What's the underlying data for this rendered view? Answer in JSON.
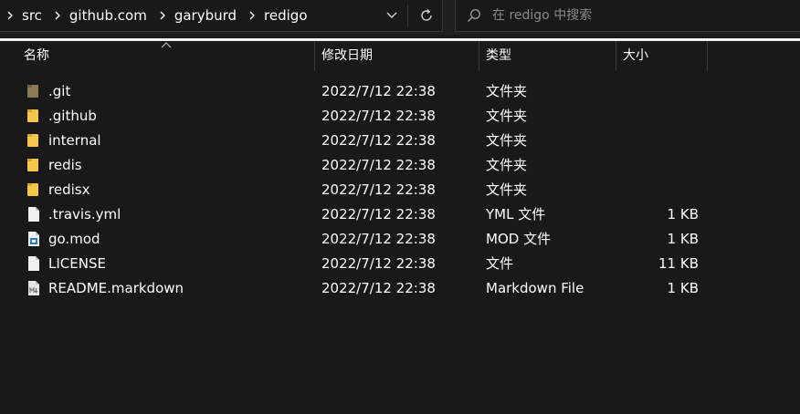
{
  "address": {
    "crumbs": [
      "src",
      "github.com",
      "garyburd",
      "redigo"
    ]
  },
  "search": {
    "placeholder": "在 redigo 中搜索"
  },
  "columns": {
    "name": "名称",
    "date": "修改日期",
    "type": "类型",
    "size": "大小"
  },
  "files": [
    {
      "name": ".git",
      "date": "2022/7/12 22:38",
      "type": "文件夹",
      "size": "",
      "icon": "folder-icon-dim"
    },
    {
      "name": ".github",
      "date": "2022/7/12 22:38",
      "type": "文件夹",
      "size": "",
      "icon": "folder-icon"
    },
    {
      "name": "internal",
      "date": "2022/7/12 22:38",
      "type": "文件夹",
      "size": "",
      "icon": "folder-icon"
    },
    {
      "name": "redis",
      "date": "2022/7/12 22:38",
      "type": "文件夹",
      "size": "",
      "icon": "folder-icon"
    },
    {
      "name": "redisx",
      "date": "2022/7/12 22:38",
      "type": "文件夹",
      "size": "",
      "icon": "folder-icon"
    },
    {
      "name": ".travis.yml",
      "date": "2022/7/12 22:38",
      "type": "YML 文件",
      "size": "1 KB",
      "icon": "file-icon"
    },
    {
      "name": "go.mod",
      "date": "2022/7/12 22:38",
      "type": "MOD 文件",
      "size": "1 KB",
      "icon": "mod-file-icon"
    },
    {
      "name": "LICENSE",
      "date": "2022/7/12 22:38",
      "type": "文件",
      "size": "11 KB",
      "icon": "file-icon"
    },
    {
      "name": "README.markdown",
      "date": "2022/7/12 22:38",
      "type": "Markdown File",
      "size": "1 KB",
      "icon": "markdown-file-icon"
    }
  ],
  "colors": {
    "background": "#191919",
    "folder": "#f5c74a",
    "folder_dim": "#8a7a55",
    "text": "#ffffff",
    "divider": "#3a3a3a"
  }
}
